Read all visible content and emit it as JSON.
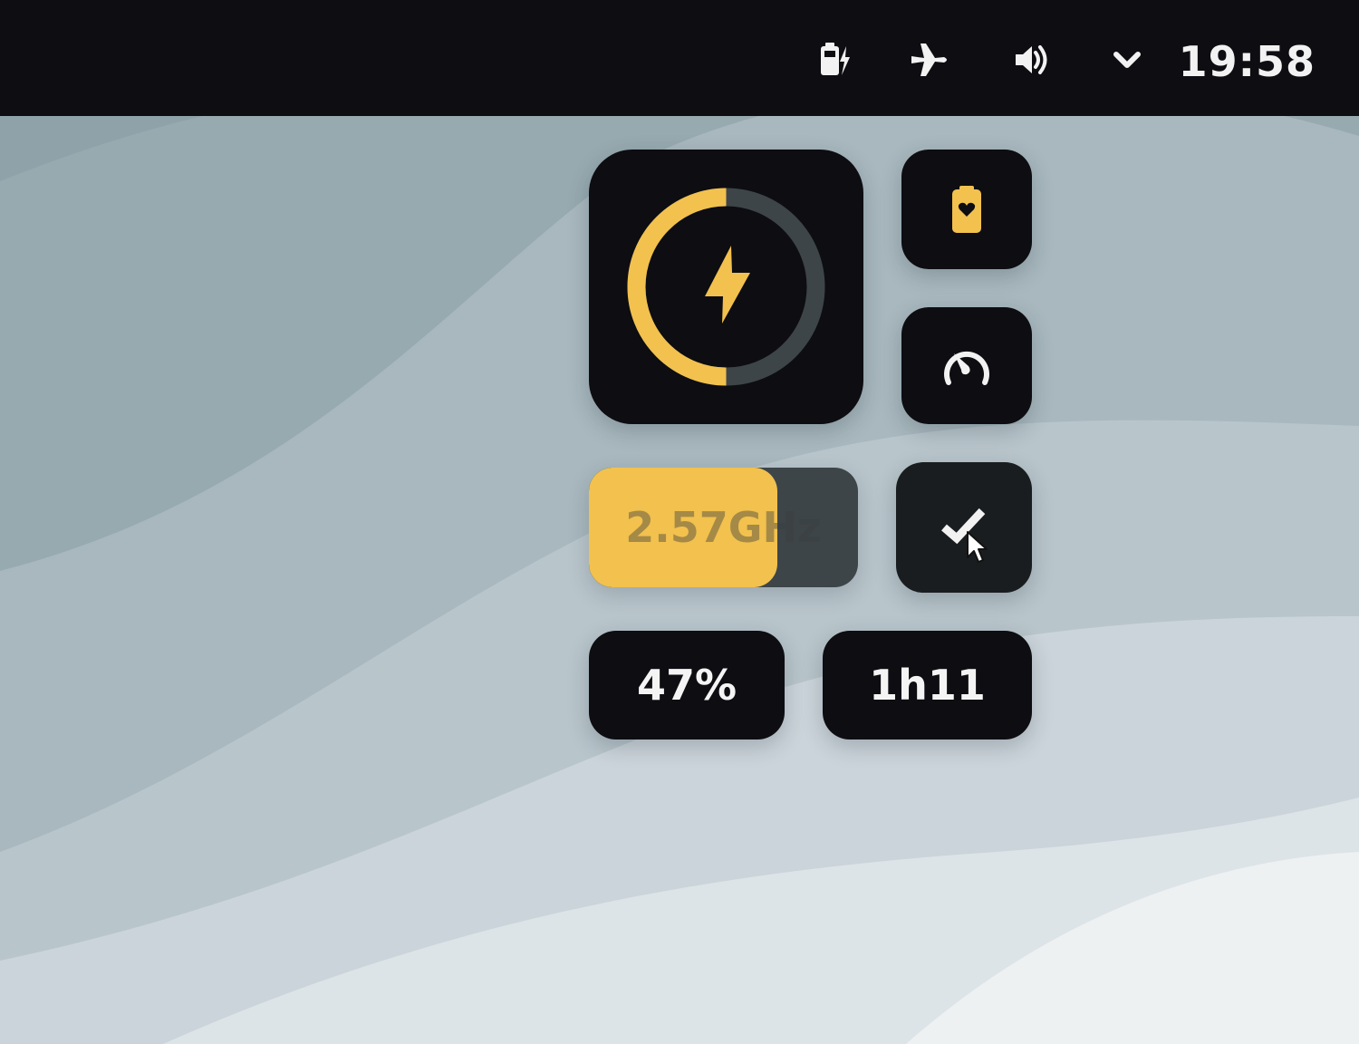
{
  "topbar": {
    "clock": "19:58",
    "icons": [
      "battery-charging-icon",
      "airplane-mode-icon",
      "volume-icon",
      "chevron-down-icon"
    ]
  },
  "widgets": {
    "power_ring": {
      "icon": "lightning-bolt-icon",
      "level": 0.5
    },
    "battery_health_icon": "battery-heart-icon",
    "performance_icon": "speedometer-icon",
    "cpu_frequency": {
      "label": "2.57GHz",
      "fill_fraction": 0.7
    },
    "confirm_icon": "checkmark-icon",
    "battery_percent": "47%",
    "time_remaining": "1h11"
  },
  "colors": {
    "accent": "#f2c14e",
    "tile_bg": "#0d0d12",
    "track": "#3d4549",
    "topbar_bg": "#0d0d12"
  }
}
